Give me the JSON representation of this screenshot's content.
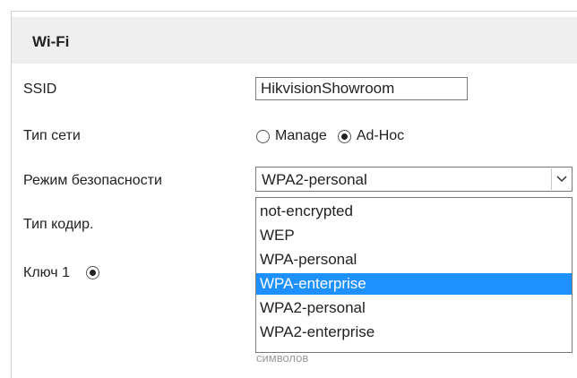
{
  "section": {
    "title": "Wi-Fi"
  },
  "ssid": {
    "label": "SSID",
    "value": "HikvisionShowroom"
  },
  "network_type": {
    "label": "Тип сети",
    "options": [
      {
        "label": "Manage",
        "checked": false
      },
      {
        "label": "Ad-Hoc",
        "checked": true
      }
    ]
  },
  "security_mode": {
    "label": "Режим безопасности",
    "selected": "WPA2-personal",
    "options": [
      "not-encrypted",
      "WEP",
      "WPA-personal",
      "WPA-enterprise",
      "WPA2-personal",
      "WPA2-enterprise"
    ],
    "highlighted": "WPA-enterprise"
  },
  "encryption": {
    "label": "Тип кодир."
  },
  "key1": {
    "label": "Ключ 1",
    "checked": true
  },
  "partial_text": "символов",
  "colors": {
    "highlight": "#1e90ff",
    "header_bg": "#efefef"
  }
}
